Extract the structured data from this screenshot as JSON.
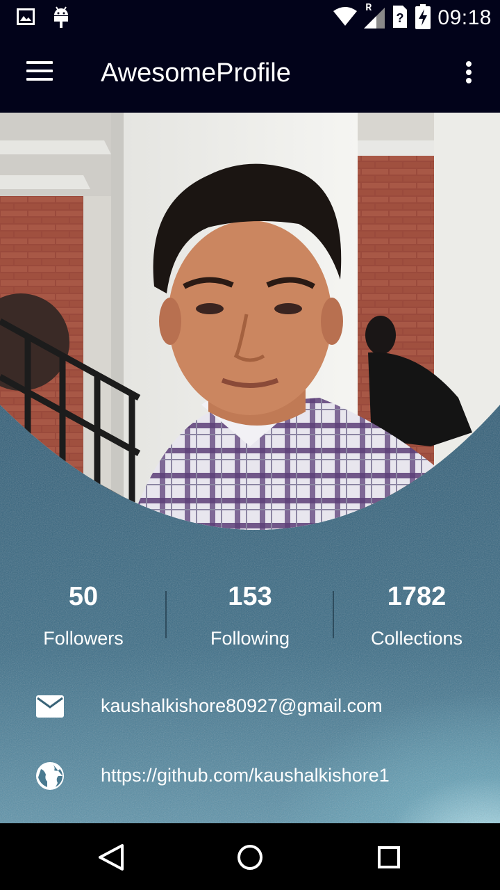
{
  "status_bar": {
    "time": "09:18",
    "icons": [
      "gallery-icon",
      "android-icon",
      "wifi-icon",
      "signal-icon",
      "sim-alert-icon",
      "battery-charging-icon"
    ],
    "roaming_label": "R"
  },
  "app_bar": {
    "title": "AwesomeProfile",
    "menu_icon": "hamburger-menu-icon",
    "overflow_icon": "more-vert-icon"
  },
  "profile": {
    "photo_alt": "profile-photo"
  },
  "stats": [
    {
      "value": "50",
      "label": "Followers"
    },
    {
      "value": "153",
      "label": "Following"
    },
    {
      "value": "1782",
      "label": "Collections"
    }
  ],
  "contact": {
    "email": "kaushalkishore80927@gmail.com",
    "email_icon": "mail-icon",
    "website": "https://github.com/kaushalkishore1",
    "website_icon": "globe-icon"
  },
  "nav_bar": {
    "back_icon": "back-triangle-icon",
    "home_icon": "home-circle-icon",
    "recents_icon": "recents-square-icon"
  },
  "colors": {
    "app_bar": "#02031a",
    "background_dark": "#2a5068",
    "background_light": "#bfe8f2"
  }
}
